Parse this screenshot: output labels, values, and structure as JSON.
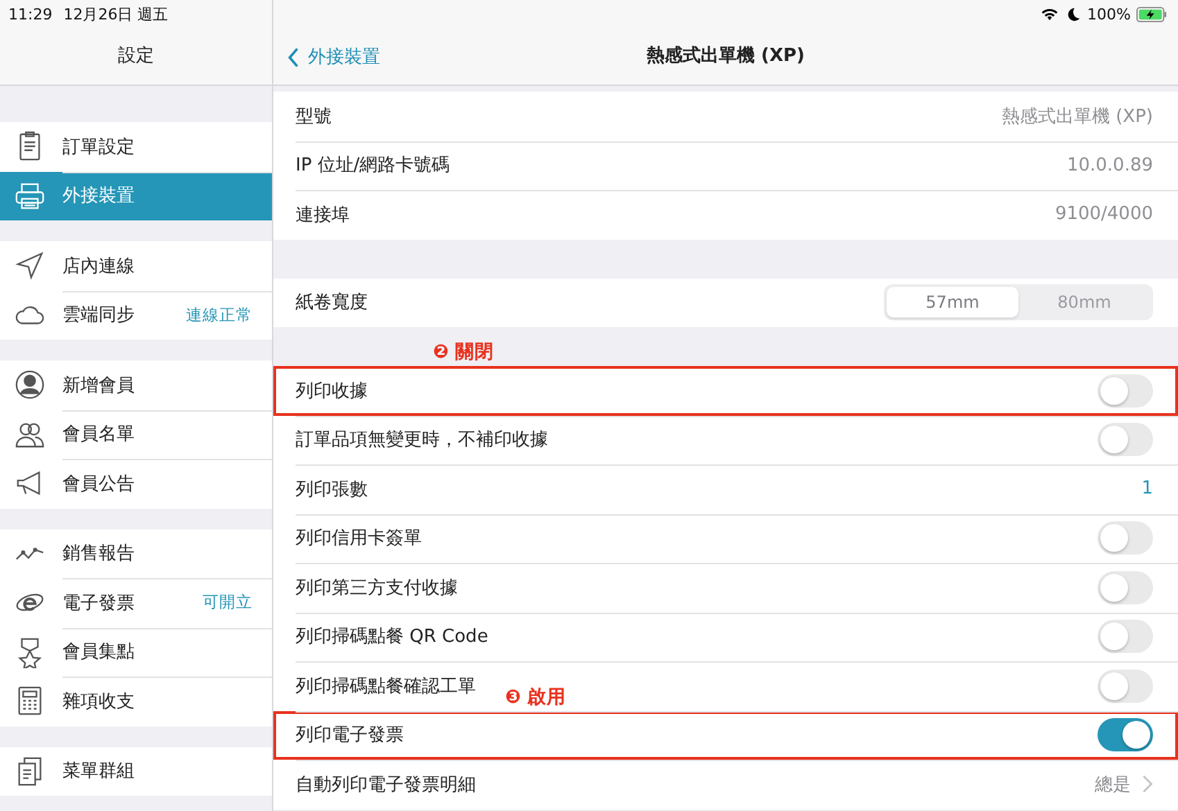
{
  "status_bar": {
    "time": "11:29",
    "date": "12月26日 週五",
    "battery": "100%"
  },
  "sidebar": {
    "title": "設定",
    "groups": [
      {
        "items": [
          {
            "label": "訂單設定",
            "selected": false
          },
          {
            "label": "外接裝置",
            "selected": true
          }
        ]
      },
      {
        "items": [
          {
            "label": "店內連線",
            "selected": false
          },
          {
            "label": "雲端同步",
            "detail": "連線正常",
            "selected": false
          }
        ]
      },
      {
        "items": [
          {
            "label": "新增會員",
            "selected": false
          },
          {
            "label": "會員名單",
            "selected": false
          },
          {
            "label": "會員公告",
            "selected": false
          }
        ]
      },
      {
        "items": [
          {
            "label": "銷售報告",
            "selected": false
          },
          {
            "label": "電子發票",
            "detail": "可開立",
            "selected": false
          },
          {
            "label": "會員集點",
            "selected": false
          },
          {
            "label": "雜項收支",
            "selected": false
          }
        ]
      },
      {
        "items": [
          {
            "label": "菜單群組",
            "selected": false
          }
        ]
      }
    ]
  },
  "detail": {
    "back": "外接裝置",
    "title": "熱感式出單機 (XP)",
    "groups": [
      {
        "rows": [
          {
            "kind": "value",
            "label": "型號",
            "value": "熱感式出單機 (XP)"
          },
          {
            "kind": "value",
            "label": "IP 位址/網路卡號碼",
            "value": "10.0.0.89"
          },
          {
            "kind": "value",
            "label": "連接埠",
            "value": "9100/4000"
          }
        ]
      },
      {
        "rows": [
          {
            "kind": "segmented",
            "label": "紙卷寬度",
            "segments": [
              {
                "label": "57mm",
                "selected": true
              },
              {
                "label": "80mm",
                "selected": false
              }
            ]
          }
        ]
      },
      {
        "rows": [
          {
            "kind": "toggle",
            "label": "列印收據",
            "on": false,
            "highlighted": true,
            "note": "❷ 關閉"
          },
          {
            "kind": "toggle",
            "label": "訂單品項無變更時，不補印收據",
            "on": false,
            "highlighted": false
          },
          {
            "kind": "number",
            "label": "列印張數",
            "value": "1",
            "highlighted": false
          },
          {
            "kind": "toggle",
            "label": "列印信用卡簽單",
            "on": false,
            "highlighted": false
          },
          {
            "kind": "toggle",
            "label": "列印第三方支付收據",
            "on": false,
            "highlighted": false
          },
          {
            "kind": "toggle",
            "label": "列印掃碼點餐 QR Code",
            "on": false,
            "highlighted": false
          },
          {
            "kind": "toggle",
            "label": "列印掃碼點餐確認工單",
            "on": false,
            "highlighted": false
          },
          {
            "kind": "toggle",
            "label": "列印電子發票",
            "on": true,
            "highlighted": true,
            "note": "❸ 啟用"
          },
          {
            "kind": "disclosure",
            "label": "自動列印電子發票明細",
            "value": "總是",
            "highlighted": false
          }
        ]
      }
    ]
  }
}
